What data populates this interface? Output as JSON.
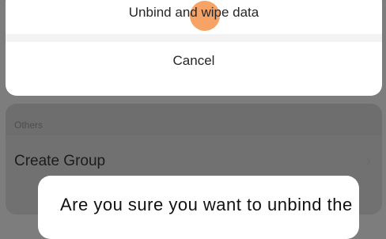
{
  "action_sheet": {
    "wipe_label": "Unbind and wipe data",
    "cancel_label": "Cancel"
  },
  "settings": {
    "section_label": "Others",
    "create_group_label": "Create Group",
    "chevron_icon": "chevron-right-icon"
  },
  "dialog": {
    "text": "Are you sure you want to unbind the"
  }
}
